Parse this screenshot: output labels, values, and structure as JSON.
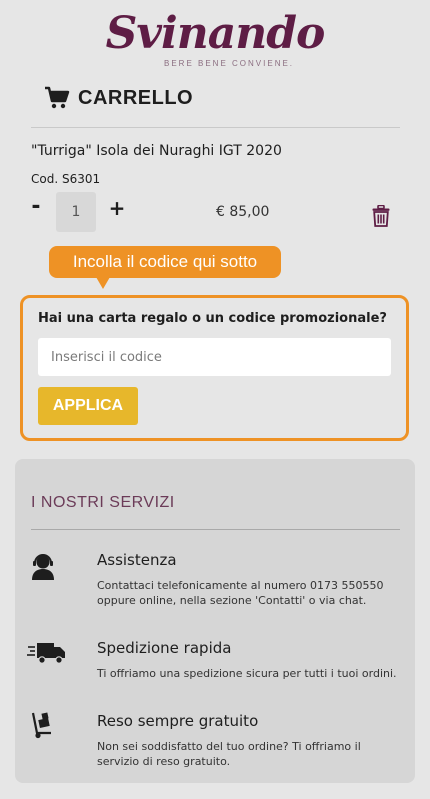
{
  "brand": {
    "name": "Svinando",
    "tagline": "BERE BENE CONVIENE."
  },
  "cart": {
    "title": "CARRELLO",
    "product": {
      "name": "\"Turriga\" Isola dei Nuraghi IGT 2020",
      "code": "Cod. S6301",
      "minus": "-",
      "plus": "+",
      "quantity": "1",
      "price": "€ 85,00"
    }
  },
  "promo": {
    "tooltip": "Incolla il codice qui sotto",
    "title": "Hai una carta regalo o un codice promozionale?",
    "placeholder": "Inserisci il codice",
    "apply_label": "APPLICA"
  },
  "services": {
    "title": "I NOSTRI SERVIZI",
    "items": [
      {
        "icon": "support-agent-icon",
        "title": "Assistenza",
        "text": "Contattaci telefonicamente al numero 0173 550550 oppure online, nella sezione 'Contatti' o via chat."
      },
      {
        "icon": "delivery-truck-icon",
        "title": "Spedizione rapida",
        "text": "Ti offriamo una spedizione sicura per tutti i tuoi ordini."
      },
      {
        "icon": "hand-truck-icon",
        "title": "Reso sempre gratuito",
        "text": "Non sei soddisfatto del tuo ordine? Ti offriamo il servizio di reso gratuito."
      }
    ]
  },
  "colors": {
    "brand": "#5e1d45",
    "accent_orange": "#ee9225",
    "button_yellow": "#e7b72b",
    "services_title": "#6b3b58"
  }
}
